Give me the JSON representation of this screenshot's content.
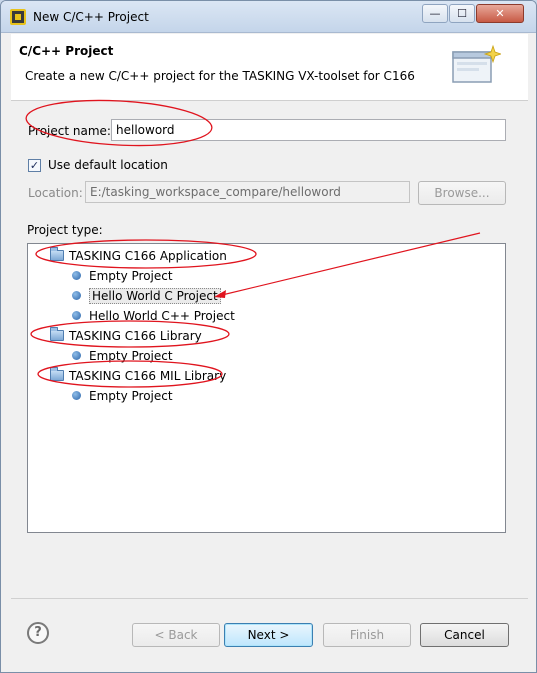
{
  "window": {
    "title": "New C/C++ Project",
    "minimize": "—",
    "maximize": "☐",
    "close": "✕"
  },
  "header": {
    "title": "C/C++ Project",
    "description": "Create a new C/C++ project for the TASKING VX-toolset for C166"
  },
  "form": {
    "project_name_label": "Project name:",
    "project_name_value": "helloword",
    "use_default_location_label": "Use default location",
    "use_default_location_checked": true,
    "location_label": "Location:",
    "location_value": "E:/tasking_workspace_compare/helloword",
    "browse_label": "Browse...",
    "project_type_label": "Project type:"
  },
  "tree": {
    "items": [
      {
        "label": "TASKING C166 Application",
        "type": "folder",
        "level": 0
      },
      {
        "label": "Empty Project",
        "type": "project",
        "level": 1
      },
      {
        "label": "Hello World C Project",
        "type": "project",
        "level": 1,
        "selected": true
      },
      {
        "label": "Hello World C++ Project",
        "type": "project",
        "level": 1
      },
      {
        "label": "TASKING C166 Library",
        "type": "folder",
        "level": 0
      },
      {
        "label": "Empty Project",
        "type": "project",
        "level": 1
      },
      {
        "label": "TASKING C166 MIL Library",
        "type": "folder",
        "level": 0
      },
      {
        "label": "Empty Project",
        "type": "project",
        "level": 1
      }
    ]
  },
  "buttons": {
    "help": "?",
    "back": "< Back",
    "next": "Next >",
    "finish": "Finish",
    "cancel": "Cancel"
  },
  "annotation_color": "#e0141e",
  "icons": [
    "app-chip-icon",
    "wizard-window-icon",
    "folder-icon",
    "project-bullet-icon",
    "help-icon"
  ]
}
